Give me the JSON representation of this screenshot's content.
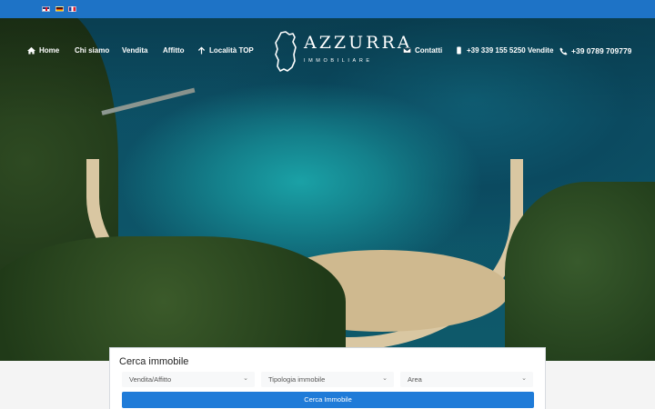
{
  "languages": [
    {
      "name": "English",
      "icon": "uk-flag-icon"
    },
    {
      "name": "Deutsch",
      "icon": "germany-flag-icon"
    },
    {
      "name": "Français",
      "icon": "france-flag-icon"
    }
  ],
  "nav": {
    "home": "Home",
    "about": "Chi siamo",
    "sale": "Vendita",
    "rent": "Affitto",
    "top_locations": "Località TOP",
    "contacts": "Contatti",
    "phone_sales": "+39 339 155 5250 Vendite",
    "phone_main": "+39 0789 709779"
  },
  "logo": {
    "brand": "AZZURRA",
    "sub": "IMMOBILIARE"
  },
  "search": {
    "title": "Cerca immobile",
    "type_select": "Vendita/Affitto",
    "category_select": "Tipologia immobile",
    "area_select": "Area",
    "button": "Cerca Immobile"
  },
  "colors": {
    "topbar": "#1e73c6",
    "button": "#1f7bd8"
  }
}
